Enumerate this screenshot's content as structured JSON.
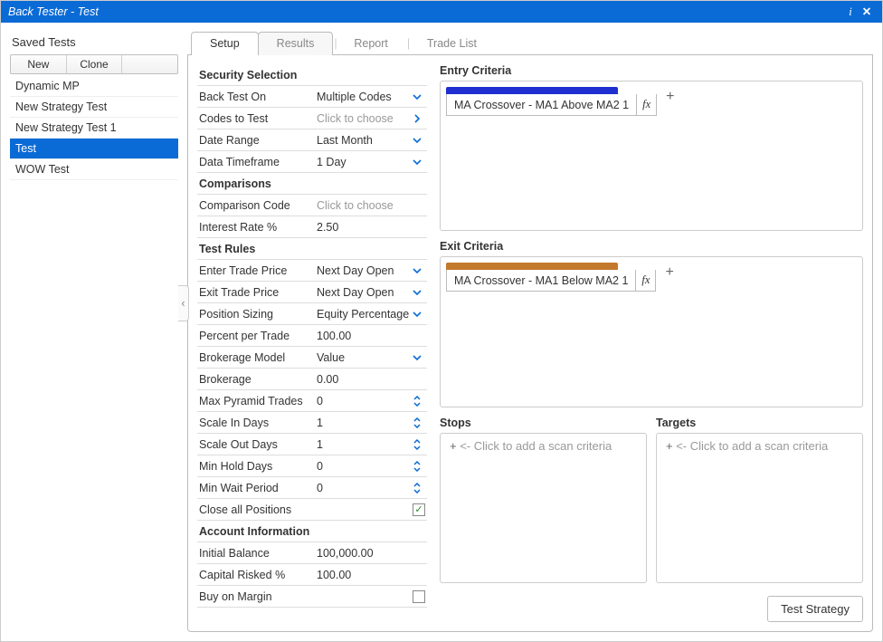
{
  "window": {
    "title": "Back Tester - Test"
  },
  "left": {
    "header": "Saved Tests",
    "buttons": {
      "new": "New",
      "clone": "Clone",
      "blank": ""
    },
    "tests": [
      "Dynamic MP",
      "New Strategy Test",
      "New Strategy Test 1",
      "Test",
      "WOW Test"
    ],
    "selected_index": 3
  },
  "tabs": {
    "setup": "Setup",
    "results": "Results",
    "report": "Report",
    "tradelist": "Trade List"
  },
  "props": {
    "sec_sel": "Security Selection",
    "back_test_on": {
      "label": "Back Test On",
      "value": "Multiple Codes"
    },
    "codes_to_test": {
      "label": "Codes to Test",
      "value": "Click to choose",
      "placeholder": true
    },
    "date_range": {
      "label": "Date Range",
      "value": "Last Month"
    },
    "data_tf": {
      "label": "Data Timeframe",
      "value": "1 Day"
    },
    "comparisons": "Comparisons",
    "cmp_code": {
      "label": "Comparison Code",
      "value": "Click to choose",
      "placeholder": true
    },
    "interest": {
      "label": "Interest Rate %",
      "value": "2.50"
    },
    "test_rules": "Test Rules",
    "enter_price": {
      "label": "Enter Trade Price",
      "value": "Next Day Open"
    },
    "exit_price": {
      "label": "Exit Trade Price",
      "value": "Next Day Open"
    },
    "pos_sizing": {
      "label": "Position Sizing",
      "value": "Equity Percentage"
    },
    "pct_trade": {
      "label": "Percent per Trade",
      "value": "100.00"
    },
    "brk_model": {
      "label": "Brokerage Model",
      "value": "Value"
    },
    "brokerage": {
      "label": "Brokerage",
      "value": "0.00"
    },
    "max_pyr": {
      "label": "Max Pyramid Trades",
      "value": "0"
    },
    "scale_in": {
      "label": "Scale In Days",
      "value": "1"
    },
    "scale_out": {
      "label": "Scale Out Days",
      "value": "1"
    },
    "min_hold": {
      "label": "Min Hold Days",
      "value": "0"
    },
    "min_wait": {
      "label": "Min Wait Period",
      "value": "0"
    },
    "close_all": {
      "label": "Close all Positions",
      "checked": true
    },
    "acct_info": "Account Information",
    "initial_bal": {
      "label": "Initial Balance",
      "value": "100,000.00"
    },
    "cap_risk": {
      "label": "Capital Risked %",
      "value": "100.00"
    },
    "buy_margin": {
      "label": "Buy on Margin",
      "checked": false
    }
  },
  "entry": {
    "title": "Entry Criteria",
    "item_text": "MA Crossover - MA1 Above MA2 1",
    "bar_color": "#1f2fd0",
    "fx_label": "fx"
  },
  "exit": {
    "title": "Exit Criteria",
    "item_text": "MA Crossover - MA1 Below MA2 1",
    "bar_color": "#c3792b",
    "fx_label": "fx"
  },
  "stops": {
    "title": "Stops",
    "hint": "<- Click to add a scan criteria"
  },
  "targets": {
    "title": "Targets",
    "hint": "<- Click to add a scan criteria"
  },
  "footer": {
    "test_btn": "Test Strategy"
  },
  "glyphs": {
    "plus": "+",
    "chev_down": "⌄",
    "chev_right": "›",
    "spinner": "↕",
    "chev_left": "‹"
  }
}
